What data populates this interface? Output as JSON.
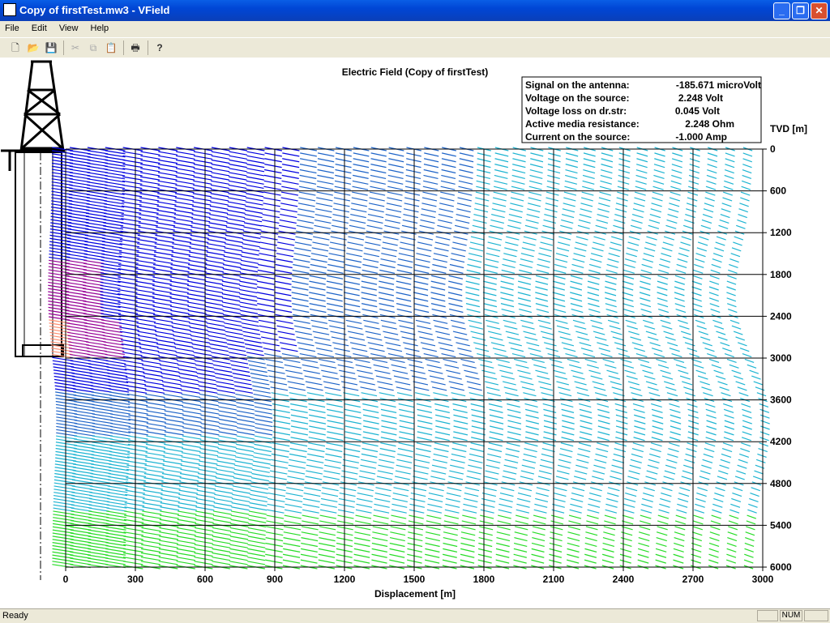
{
  "window": {
    "title": "Copy of firstTest.mw3 - VField",
    "controls": [
      "_",
      "❐",
      "✕"
    ]
  },
  "menu": [
    "File",
    "Edit",
    "View",
    "Help"
  ],
  "toolbar": {
    "buttons": [
      {
        "name": "new-icon",
        "glyph": "🗋"
      },
      {
        "name": "open-icon",
        "glyph": "📂"
      },
      {
        "name": "save-icon",
        "glyph": "💾"
      },
      {
        "name": "cut-icon",
        "glyph": "✂"
      },
      {
        "name": "copy-icon",
        "glyph": "⧉"
      },
      {
        "name": "paste-icon",
        "glyph": "📋"
      },
      {
        "name": "print-icon",
        "glyph": "🖶"
      },
      {
        "name": "help-icon",
        "glyph": "?"
      }
    ]
  },
  "plot": {
    "title": "Electric Field (Copy of firstTest)",
    "info_lines": [
      {
        "label": "Signal on the antenna:",
        "value": "-185.671 microVolt"
      },
      {
        "label": "Voltage on the source:",
        "value": "2.248 Volt"
      },
      {
        "label": "Voltage loss on dr.str:",
        "value": "0.045 Volt"
      },
      {
        "label": "Active media resistance:",
        "value": "2.248 Ohm"
      },
      {
        "label": "Current on the source:",
        "value": "-1.000 Amp"
      }
    ]
  },
  "chart_data": {
    "type": "vector-field",
    "title": "Electric Field (Copy of firstTest)",
    "xlabel": "Displacement [m]",
    "ylabel": "TVD [m]",
    "xlim": [
      0,
      3000
    ],
    "ylim": [
      0,
      6000
    ],
    "x_ticks": [
      0,
      300,
      600,
      900,
      1200,
      1500,
      1800,
      2100,
      2400,
      2700,
      3000
    ],
    "y_ticks": [
      0,
      600,
      1200,
      1800,
      2400,
      3000,
      3600,
      4200,
      4800,
      5400,
      6000
    ],
    "grid": true,
    "colors": {
      "deep": "#0000e0",
      "mid": "#1e64c8",
      "light": "#1eb4d2",
      "green": "#28dc28",
      "magenta": "#960096",
      "salmon": "#ff8c6e"
    }
  },
  "status": {
    "text": "Ready",
    "panels": [
      "",
      "NUM",
      ""
    ]
  }
}
